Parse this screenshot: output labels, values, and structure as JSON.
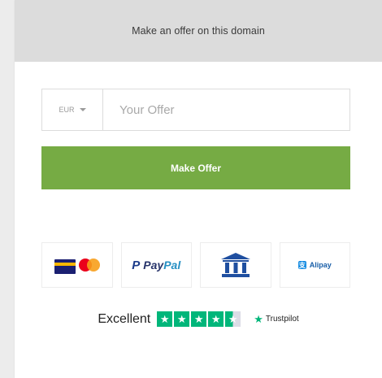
{
  "header": {
    "title": "Make an offer on this domain"
  },
  "offer_form": {
    "currency": "EUR",
    "input_placeholder": "Your Offer",
    "submit_label": "Make Offer"
  },
  "payment_methods": [
    {
      "name": "visa-mastercard",
      "label": ""
    },
    {
      "name": "paypal",
      "label_p": "P",
      "label_pay": "Pay",
      "label_pal": "Pal"
    },
    {
      "name": "bank-transfer",
      "label": ""
    },
    {
      "name": "alipay",
      "label": "Alipay"
    }
  ],
  "trust": {
    "rating_text": "Excellent",
    "stars": 4.5,
    "provider": "Trustpilot"
  },
  "colors": {
    "header_bg": "#dcdcdc",
    "button_green": "#76ab44",
    "trustpilot_green": "#00b67a",
    "paypal_navy": "#27346a",
    "paypal_blue": "#2790c3"
  }
}
